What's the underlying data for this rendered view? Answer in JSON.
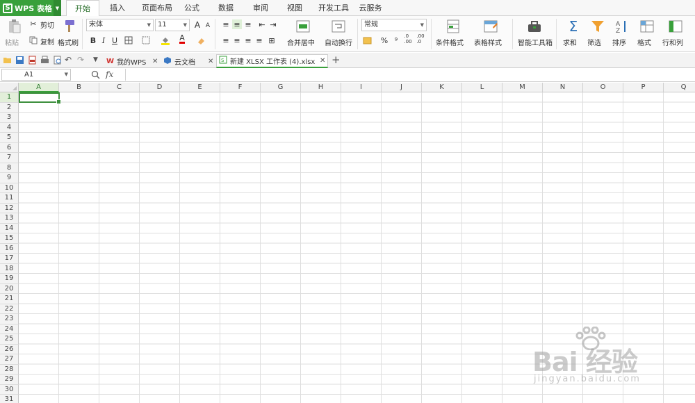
{
  "app": {
    "title": "WPS 表格",
    "logo_letter": "S"
  },
  "menu_tabs": [
    "开始",
    "插入",
    "页面布局",
    "公式",
    "数据",
    "审阅",
    "视图",
    "开发工具",
    "云服务"
  ],
  "ribbon": {
    "paste": "粘贴",
    "cut": "剪切",
    "copy": "复制",
    "format_painter": "格式刷",
    "font_name": "宋体",
    "font_size": "11",
    "bold": "B",
    "italic": "I",
    "underline": "U",
    "merge_center": "合并居中",
    "wrap_text": "自动换行",
    "number_format": "常规",
    "percent": "%",
    "comma": "⁹",
    "dec_inc": ".0\n.00",
    "dec_dec": ".00\n.0",
    "conditional_format": "条件格式",
    "table_style": "表格样式",
    "smart_toolbox": "智能工具箱",
    "sum": "求和",
    "filter": "筛选",
    "sort": "排序",
    "format": "格式",
    "row_col": "行和列",
    "font_color_letter": "A",
    "grow_font": "A",
    "shrink_font": "A"
  },
  "doc_tabs": [
    {
      "label": "我的WPS",
      "active": false
    },
    {
      "label": "云文档",
      "active": false
    },
    {
      "label": "新建 XLSX 工作表 (4).xlsx",
      "active": true
    }
  ],
  "formula_bar": {
    "cell_ref": "A1",
    "fx": "fx",
    "value": ""
  },
  "columns": [
    "A",
    "B",
    "C",
    "D",
    "E",
    "F",
    "G",
    "H",
    "I",
    "J",
    "K",
    "L",
    "M",
    "N",
    "O",
    "P",
    "Q"
  ],
  "rows": [
    "1",
    "2",
    "3",
    "4",
    "5",
    "6",
    "7",
    "8",
    "9",
    "10",
    "11",
    "12",
    "13",
    "14",
    "15",
    "16",
    "17",
    "18",
    "19",
    "20",
    "21",
    "22",
    "23",
    "24",
    "25",
    "26",
    "27",
    "28",
    "29",
    "30",
    "31"
  ],
  "selected_cell": "A1",
  "watermark": {
    "brand": "Bai 经验",
    "url": "jingyan.baidu.com"
  },
  "colors": {
    "accent": "#39a03b",
    "accent_dark": "#2f8a31",
    "grid": "#dedede"
  }
}
